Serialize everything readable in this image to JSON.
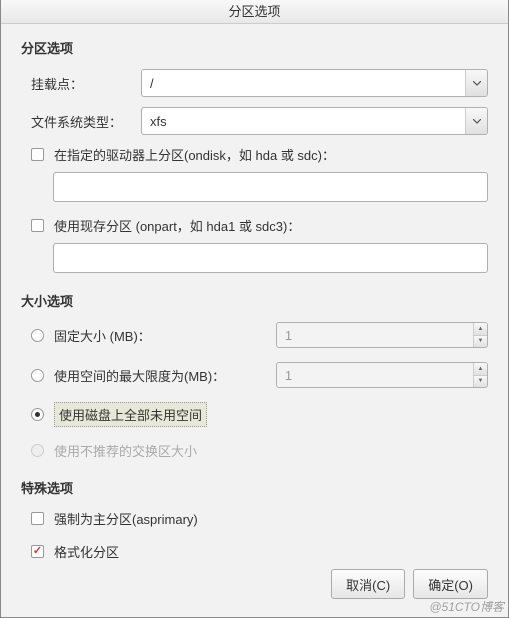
{
  "title": "分区选项",
  "partition_options": {
    "heading": "分区选项",
    "mount_point": {
      "label": "挂载点：",
      "value": "/"
    },
    "fs_type": {
      "label": "文件系统类型：",
      "value": "xfs"
    },
    "ondisk": {
      "label": "在指定的驱动器上分区(ondisk，如 hda 或 sdc)：",
      "value": ""
    },
    "onpart": {
      "label": "使用现存分区 (onpart，如 hda1 或 sdc3)：",
      "value": ""
    }
  },
  "size_options": {
    "heading": "大小选项",
    "fixed": {
      "label": "固定大小 (MB)：",
      "value": "1"
    },
    "max": {
      "label": "使用空间的最大限度为(MB)：",
      "value": "1"
    },
    "fill": {
      "label": "使用磁盘上全部未用空间"
    },
    "swap": {
      "label": "使用不推荐的交换区大小"
    }
  },
  "special_options": {
    "heading": "特殊选项",
    "asprimary": {
      "label": "强制为主分区(asprimary)"
    },
    "format": {
      "label": "格式化分区"
    }
  },
  "buttons": {
    "cancel": "取消(C)",
    "ok": "确定(O)"
  },
  "watermark": "@51CTO博客"
}
